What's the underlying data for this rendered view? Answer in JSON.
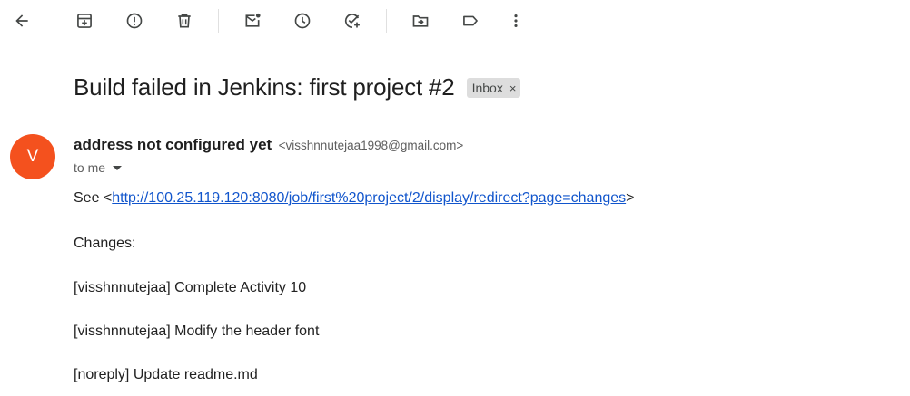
{
  "toolbar": {
    "buttons": [
      {
        "name": "back-button",
        "icon": "arrow-back-icon"
      },
      {
        "name": "archive-button",
        "icon": "archive-icon"
      },
      {
        "name": "report-spam-button",
        "icon": "report-spam-icon"
      },
      {
        "name": "delete-button",
        "icon": "trash-icon"
      },
      {
        "name": "mark-unread-button",
        "icon": "mark-unread-icon"
      },
      {
        "name": "snooze-button",
        "icon": "clock-icon"
      },
      {
        "name": "add-task-button",
        "icon": "add-task-icon"
      },
      {
        "name": "move-to-button",
        "icon": "folder-move-icon"
      },
      {
        "name": "labels-button",
        "icon": "label-icon"
      },
      {
        "name": "more-button",
        "icon": "more-vert-icon"
      }
    ]
  },
  "email": {
    "subject": "Build failed in Jenkins: first project #2",
    "label": "Inbox",
    "label_remove": "×",
    "sender": {
      "initial": "V",
      "avatar_color": "#f4511e",
      "name": "address not configured yet",
      "email": "<visshnnutejaa1998@gmail.com>"
    },
    "recipient": "to me",
    "body": {
      "see_prefix": "See <",
      "link": "http://100.25.119.120:8080/job/first%20project/2/display/redirect?page=changes",
      "see_suffix": ">",
      "changes_heading": "Changes:",
      "changes": [
        "[visshnnutejaa] Complete Activity 10",
        "[visshnnutejaa] Modify the header font",
        "[noreply] Update readme.md"
      ]
    }
  },
  "colors": {
    "link": "#1155cc",
    "icon": "#444746",
    "chip_bg": "#dddddd"
  }
}
